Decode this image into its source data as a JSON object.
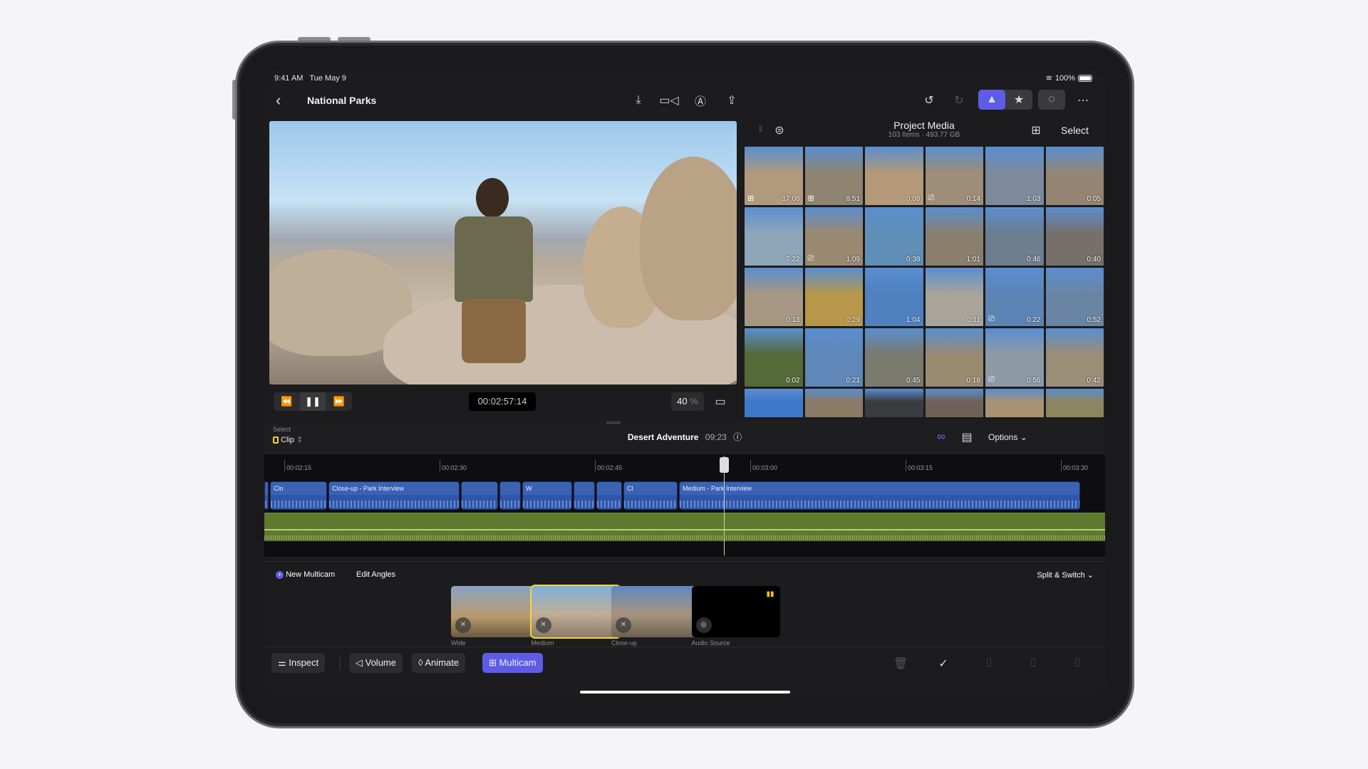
{
  "status_bar": {
    "time": "9:41 AM",
    "date": "Tue May 9",
    "battery": "100%"
  },
  "nav": {
    "back_label": "‹",
    "title": "National Parks",
    "toolbar_icons": [
      "import-icon",
      "camera-icon",
      "voiceover-icon",
      "share-icon"
    ],
    "right_icons": [
      "undo-icon",
      "redo-icon",
      "photos-icon",
      "favorites-icon",
      "snapping-icon",
      "more-icon"
    ]
  },
  "viewer": {
    "timecode": "00:02:57:14",
    "zoom": "40",
    "zoom_unit": "%",
    "transport": {
      "rewind": "⏪",
      "pause": "❚❚",
      "forward": "⏩"
    }
  },
  "browser": {
    "title": "Project Media",
    "subtitle": "103 Items · 493.77 GB",
    "select_label": "Select",
    "items": [
      {
        "dur": "17:08",
        "badge": "multicam",
        "color": "#b09a7e"
      },
      {
        "dur": "8:51",
        "badge": "multicam",
        "color": "#8f8470"
      },
      {
        "dur": "0:08",
        "badge": "",
        "color": "#b49a78"
      },
      {
        "dur": "0:14",
        "badge": "camera",
        "color": "#9e8d78"
      },
      {
        "dur": "1:03",
        "badge": "",
        "color": "#7c8a9c"
      },
      {
        "dur": "0:05",
        "badge": "",
        "color": "#948572"
      },
      {
        "dur": "7:22",
        "badge": "",
        "color": "#8fa6b8"
      },
      {
        "dur": "1:09",
        "badge": "camera",
        "color": "#9a8870"
      },
      {
        "dur": "0:38",
        "badge": "",
        "color": "#5f8fb6"
      },
      {
        "dur": "1:01",
        "badge": "",
        "color": "#8a7f6c"
      },
      {
        "dur": "0:46",
        "badge": "",
        "color": "#6c7e90"
      },
      {
        "dur": "0:40",
        "badge": "",
        "color": "#77706a"
      },
      {
        "dur": "0:13",
        "badge": "",
        "color": "#a69882"
      },
      {
        "dur": "0:29",
        "badge": "",
        "color": "#b8974a"
      },
      {
        "dur": "1:04",
        "badge": "",
        "color": "#4f80c0"
      },
      {
        "dur": "0:11",
        "badge": "",
        "color": "#a8a49a"
      },
      {
        "dur": "0:22",
        "badge": "camera",
        "color": "#5c84b4"
      },
      {
        "dur": "0:52",
        "badge": "",
        "color": "#6a84a4"
      },
      {
        "dur": "0:02",
        "badge": "",
        "color": "#546a38"
      },
      {
        "dur": "0:21",
        "badge": "",
        "color": "#5f88b8"
      },
      {
        "dur": "0:45",
        "badge": "",
        "color": "#7a7a6e"
      },
      {
        "dur": "0:18",
        "badge": "",
        "color": "#9a8a70"
      },
      {
        "dur": "0:56",
        "badge": "camera",
        "color": "#8c9aa6"
      },
      {
        "dur": "0:42",
        "badge": "",
        "color": "#9a8e76"
      },
      {
        "dur": "",
        "badge": "",
        "color": "#3f78c8"
      },
      {
        "dur": "",
        "badge": "",
        "color": "#8a7a66"
      },
      {
        "dur": "",
        "badge": "",
        "color": "#3a3c40"
      },
      {
        "dur": "",
        "badge": "",
        "color": "#6e6258"
      },
      {
        "dur": "",
        "badge": "",
        "color": "#a89272"
      },
      {
        "dur": "",
        "badge": "",
        "color": "#8c8660"
      }
    ]
  },
  "timeline": {
    "select_label": "Select",
    "select_value": "Clip",
    "project_name": "Desert Adventure",
    "duration": "09:23",
    "options_label": "Options",
    "ticks": [
      "00:02:15",
      "00:02:30",
      "00:02:45",
      "00:03:00",
      "00:03:15",
      "00:03:30"
    ],
    "clips": [
      {
        "label": ""
      },
      {
        "label": "Clo"
      },
      {
        "label": "Close-up - Park Interview"
      },
      {
        "label": ""
      },
      {
        "label": ""
      },
      {
        "label": "W"
      },
      {
        "label": ""
      },
      {
        "label": ""
      },
      {
        "label": "Cl"
      },
      {
        "label": "Medium - Park Interview"
      }
    ]
  },
  "multicam": {
    "new_label": "New Multicam",
    "edit_label": "Edit Angles",
    "mode_label": "Split & Switch",
    "angles": [
      {
        "label": "Wide",
        "selected": false
      },
      {
        "label": "Medium",
        "selected": true
      },
      {
        "label": "Close-up",
        "selected": false
      },
      {
        "label": "Audio Source",
        "selected": false
      }
    ]
  },
  "bottom_toolbar": {
    "inspect": "Inspect",
    "volume": "Volume",
    "animate": "Animate",
    "multicam": "Multicam"
  },
  "colors": {
    "accent": "#5e5ce6",
    "selection": "#f5d33b",
    "video_clip": "#2f56a8",
    "audio_clip": "#5f7a2f"
  }
}
